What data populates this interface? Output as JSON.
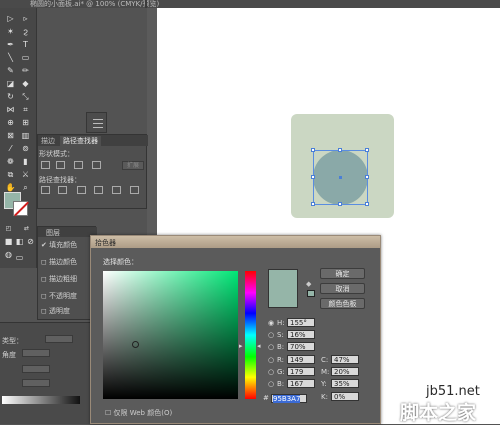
{
  "window": {
    "doc_title": "椭圆的小面板.ai* @ 100% (CMYK/预览)"
  },
  "tools": [
    "selection-tool",
    "direct-selection-tool",
    "magic-wand-tool",
    "lasso-tool",
    "pen-tool",
    "type-tool",
    "line-tool",
    "rectangle-tool",
    "paintbrush-tool",
    "pencil-tool",
    "blob-brush-tool",
    "eraser-tool",
    "rotate-tool",
    "scale-tool",
    "width-tool",
    "free-transform-tool",
    "shape-builder-tool",
    "perspective-grid-tool",
    "mesh-tool",
    "gradient-tool",
    "eyedropper-tool",
    "blend-tool",
    "symbol-sprayer-tool",
    "column-graph-tool",
    "artboard-tool",
    "slice-tool",
    "hand-tool",
    "zoom-tool"
  ],
  "pathfinder": {
    "tab_other": "描边",
    "tab_active": "路径查找器",
    "shape_modes_label": "形状模式：",
    "expand_label": "扩展",
    "pathfinders_label": "路径查找器："
  },
  "left_panel": {
    "header": "图层",
    "rows": [
      "填充颜色",
      "描边颜色",
      "描边粗细",
      "不透明度",
      "透明度"
    ]
  },
  "bottom_panel": {
    "type_label": "类型：",
    "angle_label": "角度"
  },
  "color_picker": {
    "title": "拾色器",
    "select_color_label": "选择颜色：",
    "ok_label": "确定",
    "cancel_label": "取消",
    "swatches_label": "颜色色板",
    "h_label": "H:",
    "h_value": "155°",
    "s_label": "S:",
    "s_value": "16%",
    "b_label": "B:",
    "b_value": "70%",
    "r_label": "R:",
    "r_value": "149",
    "g_label": "G:",
    "g_value": "179",
    "b2_label": "B:",
    "b2_value": "167",
    "c_label": "C:",
    "c_value": "47%",
    "m_label": "M:",
    "m_value": "20%",
    "y_label": "Y:",
    "y_value": "35%",
    "k_label": "K:",
    "k_value": "0%",
    "hex_prefix": "#",
    "hex_value": "95B3A7",
    "web_only_label": "仅限 Web 颜色(O)",
    "color_hex": "#95b5a8"
  },
  "watermark": {
    "site": "jb51.net",
    "name": "脚本之家"
  }
}
